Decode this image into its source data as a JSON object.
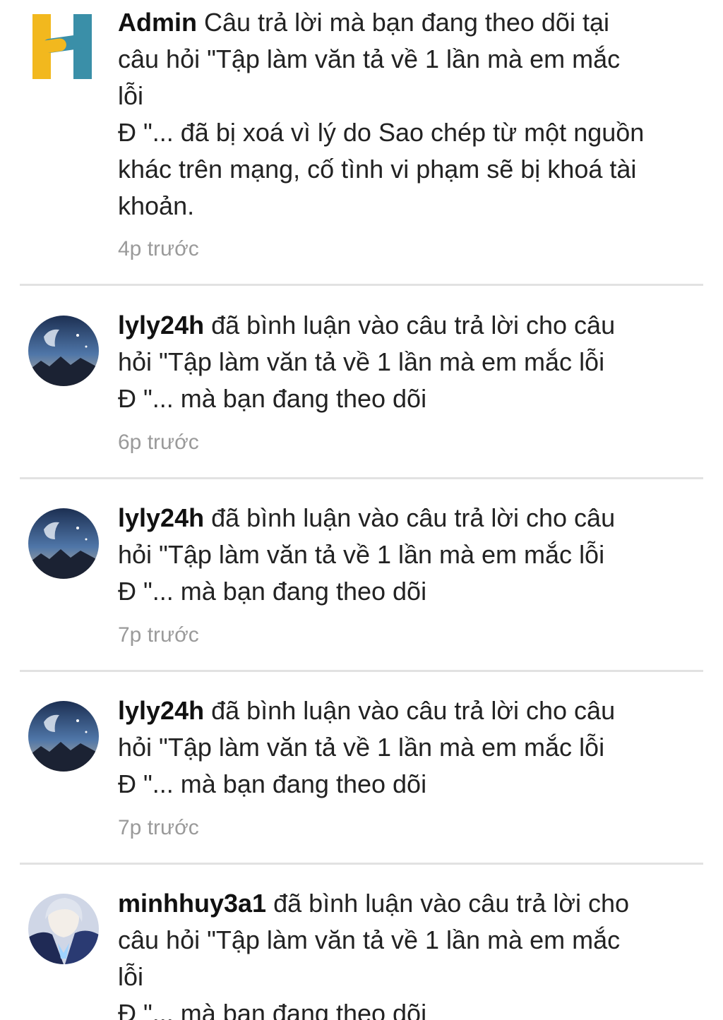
{
  "notifications": [
    {
      "avatar": "h-logo-icon",
      "user": "Admin",
      "lines": [
        "Câu trả lời mà bạn đang theo dõi tại",
        "câu hỏi \"Tập làm văn tả về 1 lần mà em mắc",
        "lỗi",
        "Đ \"... đã bị xoá vì lý do Sao chép từ một nguồn",
        "khác trên mạng, cố tình vi phạm sẽ bị khoá tài",
        "khoản."
      ],
      "time": "4p trước"
    },
    {
      "avatar": "night-sky-avatar",
      "user": "lyly24h",
      "lines": [
        "đã bình luận vào câu trả lời cho câu",
        "hỏi \"Tập làm văn tả về 1 lần mà em mắc lỗi",
        "Đ \"... mà bạn đang theo dõi"
      ],
      "time": "6p trước"
    },
    {
      "avatar": "night-sky-avatar",
      "user": "lyly24h",
      "lines": [
        "đã bình luận vào câu trả lời cho câu",
        "hỏi \"Tập làm văn tả về 1 lần mà em mắc lỗi",
        "Đ \"... mà bạn đang theo dõi"
      ],
      "time": "7p trước"
    },
    {
      "avatar": "night-sky-avatar",
      "user": "lyly24h",
      "lines": [
        "đã bình luận vào câu trả lời cho câu",
        "hỏi \"Tập làm văn tả về 1 lần mà em mắc lỗi",
        "Đ \"... mà bạn đang theo dõi"
      ],
      "time": "7p trước"
    },
    {
      "avatar": "anime-character-avatar",
      "user": "minhhuy3a1",
      "lines": [
        "đã bình luận vào câu trả lời cho",
        "câu hỏi \"Tập làm văn tả về 1 lần mà em mắc",
        "lỗi",
        "Đ \"... mà bạn đang theo dõi"
      ],
      "time": ""
    }
  ],
  "colors": {
    "logo_yellow": "#f2b81e",
    "logo_teal": "#3a8fa8",
    "time_gray": "#9a9a9a",
    "divider": "#e2e2e2"
  }
}
